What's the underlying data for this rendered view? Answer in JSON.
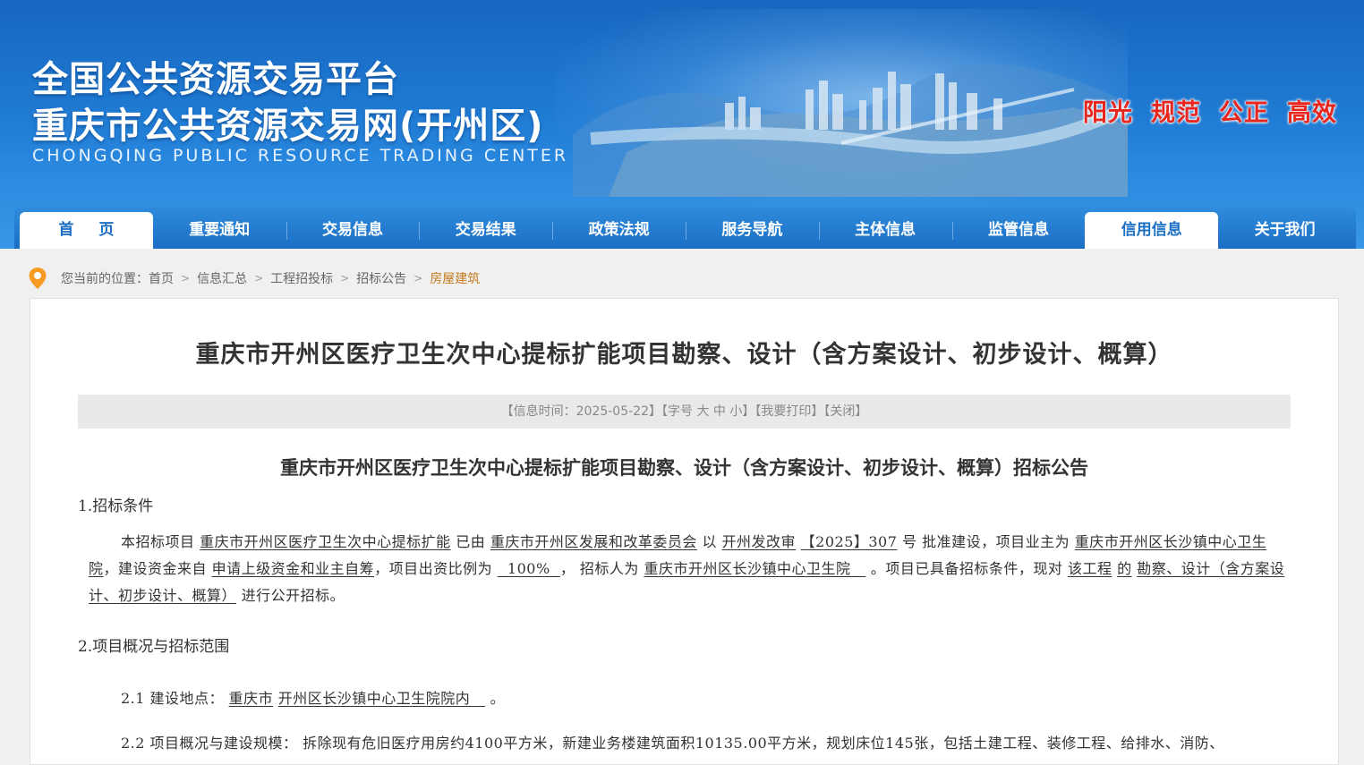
{
  "header": {
    "title_line1": "全国公共资源交易平台",
    "title_line2": "重庆市公共资源交易网(开州区)",
    "title_en": "CHONGQING PUBLIC RESOURCE TRADING CENTER",
    "slogans": [
      "阳光",
      "规范",
      "公正",
      "高效"
    ]
  },
  "nav": {
    "items": [
      {
        "label": "首页"
      },
      {
        "label": "重要通知"
      },
      {
        "label": "交易信息"
      },
      {
        "label": "交易结果"
      },
      {
        "label": "政策法规"
      },
      {
        "label": "服务导航"
      },
      {
        "label": "主体信息"
      },
      {
        "label": "监管信息"
      },
      {
        "label": "信用信息"
      },
      {
        "label": "关于我们"
      }
    ],
    "active_items": [
      "首页",
      "信用信息"
    ]
  },
  "breadcrumb": {
    "prefix": "您当前的位置：",
    "items": [
      "首页",
      "信息汇总",
      "工程招投标",
      "招标公告",
      "房屋建筑"
    ]
  },
  "article": {
    "title": "重庆市开州区医疗卫生次中心提标扩能项目勘察、设计（含方案设计、初步设计、概算）",
    "info": {
      "time_label": "【信息时间：2025-05-22】",
      "font_label": "【字号",
      "font_large": "大",
      "font_medium": "中",
      "font_small": "小】",
      "print": "【我要打印】",
      "close": "【关闭】"
    },
    "doc_title": "重庆市开州区医疗卫生次中心提标扩能项目勘察、设计（含方案设计、初步设计、概算）招标公告",
    "section1": "1.招标条件",
    "p1": {
      "t1": "本招标项目",
      "u1": "重庆市开州区医疗卫生次中心提标扩能",
      "t2": "已由",
      "u2": "重庆市开州区发展和改革委员会",
      "t3": "以",
      "u3": "开州发改审",
      "u4": "【2025】307",
      "t4": "号 批准建设，项目业主为",
      "u5": "重庆市开州区长沙镇中心卫生院",
      "t5": "，建设资金来自",
      "u6": "申请上级资金和业主自筹",
      "t6": "，项目出资比例为",
      "u7": "  100%  ",
      "t7": "，  招标人为",
      "u8": "重庆市开州区长沙镇中心卫生院   ",
      "t8": "。项目已具备招标条件，现对",
      "u9": "该工程",
      "u10": "的",
      "u11": "勘察、设计（含方案设计、初步设计、概算）",
      "t9": "进行公开招标。"
    },
    "section2": "2.项目概况与招标范围",
    "s21": {
      "label": "2.1  建设地点：",
      "u1": "重庆市",
      "u2": "开州区长沙镇中心卫生院院内   ",
      "end": "。"
    },
    "s22": {
      "text": "2.2  项目概况与建设规模：  拆除现有危旧医疗用房约4100平方米，新建业务楼建筑面积10135.00平方米，规划床位145张，包括土建工程、装修工程、给排水、消防、"
    }
  }
}
